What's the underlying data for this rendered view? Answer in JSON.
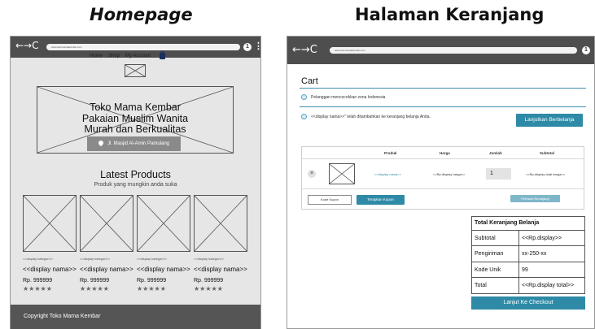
{
  "left_heading": "Homepage",
  "right_heading": "Halaman Keranjang",
  "browser": {
    "nav_glyphs": "←→C",
    "left_url": "www.tokomamakembar.com",
    "right_url": "www.tokomamakembar.com",
    "profile_glyph": "1",
    "menu_glyph": "⋮"
  },
  "homepage": {
    "nav": [
      "Home",
      "Shop",
      "My Account"
    ],
    "hero_title": [
      "Toko Mama Kembar",
      "Pakaian Muslim Wanita",
      "Murah dan Berkualitas"
    ],
    "address": "Jl. Masjid Al-Amin Pamulang",
    "section_title": "Latest Products",
    "section_subtitle": "Produk yang mungkin anda suka",
    "products": [
      {
        "category": "<<display kategori>>",
        "name": "<<display nama>>",
        "price": "Rp. 999999",
        "stars": "★★★★★"
      },
      {
        "category": "<<display kategori>>",
        "name": "<<display nama>>",
        "price": "Rp. 999999",
        "stars": "★★★★★"
      },
      {
        "category": "<<display kategori>>",
        "name": "<<display nama>>",
        "price": "Rp. 999999",
        "stars": "★★★★★"
      },
      {
        "category": "<<display kategori>>",
        "name": "<<display nama>>",
        "price": "Rp. 999999",
        "stars": "★★★★★"
      }
    ],
    "footer": "Copyright Toko Mama Kembar"
  },
  "cart": {
    "title": "Cart",
    "notice1": "Pelanggan mencocokkan zona Indonesia",
    "notice2": "<<display nama>>\" telah ditambahkan ke keranjang belanja Anda.",
    "continue_button": "Lanjutkan Berbelanja",
    "columns": [
      "Produk",
      "Harga",
      "Jumlah",
      "Subtotal"
    ],
    "remove_glyph": "×",
    "item": {
      "product": "<<display nama>>",
      "price": "<<Rp.display harga>>",
      "qty": "1",
      "subtotal": "<<Rp.display total harga>>"
    },
    "coupon_placeholder": "Kode Kupon",
    "apply_coupon": "Terapkan Kupon",
    "update_cart": "Perbarui Keranjang",
    "totals": {
      "title": "Total Keranjang Belanja",
      "rows": [
        {
          "label": "Subtotal",
          "value": "<<Rp.display>>"
        },
        {
          "label": "Pengiriman",
          "value": "xx-250-xx"
        },
        {
          "label": "Kode Unik",
          "value": "99"
        },
        {
          "label": "Total",
          "value": "<<Rp.display total>>"
        }
      ]
    },
    "checkout_button": "Lanjut Ke Checkout"
  },
  "colors": {
    "accent": "#2e8aa6",
    "dark_bar": "#4e4e4e",
    "footer": "#555555"
  }
}
